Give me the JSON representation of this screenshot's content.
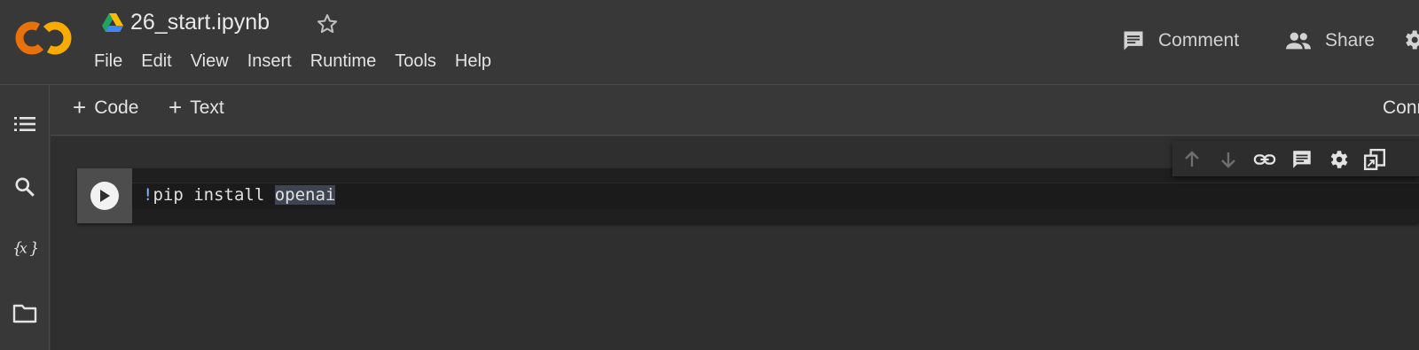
{
  "header": {
    "filename": "26_start.ipynb",
    "logo_text": "CO",
    "menu": [
      "File",
      "Edit",
      "View",
      "Insert",
      "Runtime",
      "Tools",
      "Help"
    ],
    "comment_label": "Comment",
    "share_label": "Share"
  },
  "toolbar": {
    "add_code_label": "Code",
    "add_text_label": "Text",
    "connect_label": "Connect"
  },
  "sidebar": {
    "items": [
      "toc-icon",
      "search-icon",
      "variables-icon",
      "files-icon"
    ]
  },
  "cell": {
    "code_bang": "!",
    "code_main": "pip install ",
    "code_highlight": "openai"
  },
  "colors": {
    "background": "#383838",
    "notebook_bg": "#2f2f2f",
    "cell_bg": "#1f1f1f",
    "logo_orange": "#f9ab00",
    "logo_dark_orange": "#e8710a",
    "accent_blue": "#8ab4f8"
  }
}
